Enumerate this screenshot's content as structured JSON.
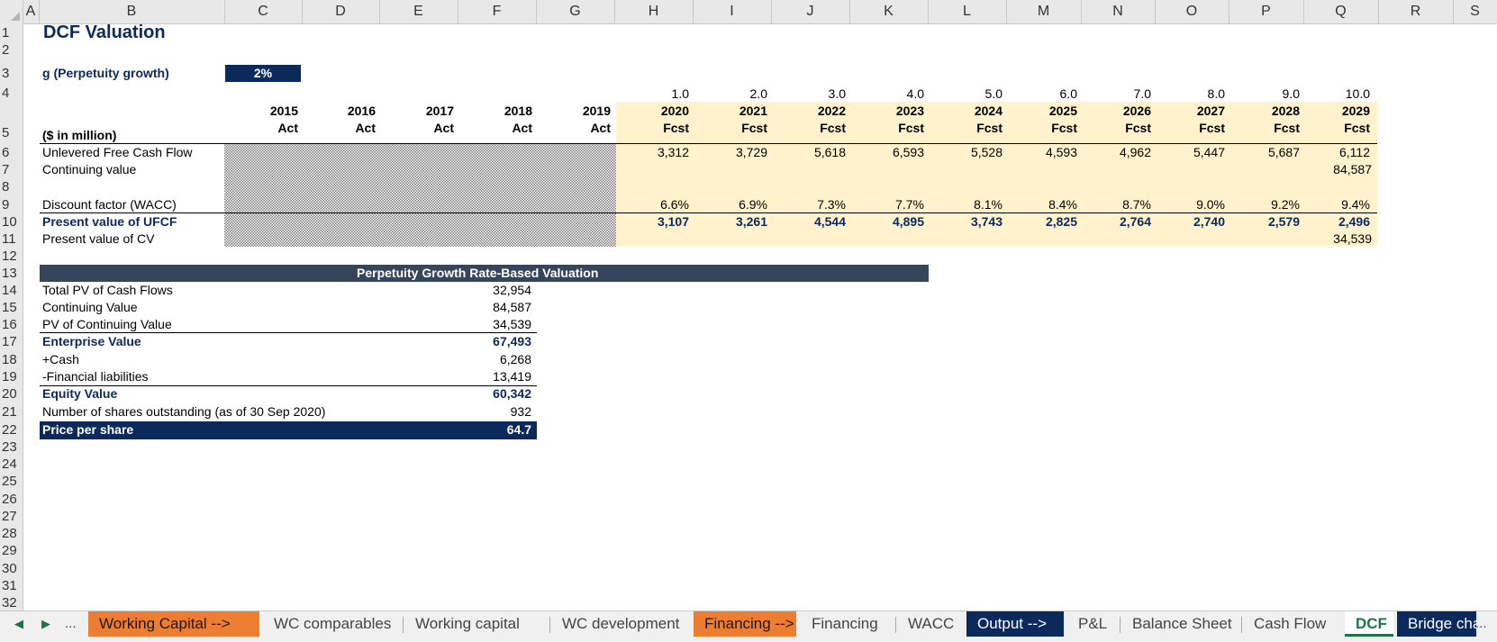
{
  "columns": [
    "A",
    "B",
    "C",
    "D",
    "E",
    "F",
    "G",
    "H",
    "I",
    "J",
    "K",
    "L",
    "M",
    "N",
    "O",
    "P",
    "Q",
    "R",
    "S"
  ],
  "rows": [
    "1",
    "2",
    "3",
    "4",
    "5",
    "6",
    "7",
    "8",
    "9",
    "10",
    "11",
    "12",
    "13",
    "14",
    "15",
    "16",
    "17",
    "18",
    "19",
    "20",
    "21",
    "22",
    "23",
    "24",
    "25",
    "26",
    "27",
    "28",
    "29",
    "30",
    "31",
    "32"
  ],
  "sheet": {
    "title": "DCF Valuation",
    "g_label": "g (Perpetuity growth)",
    "g_value": "2%",
    "units_label": "($ in million)",
    "periods": [
      "1.0",
      "2.0",
      "3.0",
      "4.0",
      "5.0",
      "6.0",
      "7.0",
      "8.0",
      "9.0",
      "10.0"
    ],
    "years": [
      "2015",
      "2016",
      "2017",
      "2018",
      "2019",
      "2020",
      "2021",
      "2022",
      "2023",
      "2024",
      "2025",
      "2026",
      "2027",
      "2028",
      "2029"
    ],
    "types": [
      "Act",
      "Act",
      "Act",
      "Act",
      "Act",
      "Fcst",
      "Fcst",
      "Fcst",
      "Fcst",
      "Fcst",
      "Fcst",
      "Fcst",
      "Fcst",
      "Fcst",
      "Fcst"
    ],
    "row_labels": {
      "ufcf": "Unlevered Free Cash Flow",
      "cv": "Continuing value",
      "df": "Discount factor (WACC)",
      "pv_ufcf": "Present value of UFCF",
      "pv_cv": "Present value of CV"
    },
    "ufcf": [
      "3,312",
      "3,729",
      "5,618",
      "6,593",
      "5,528",
      "4,593",
      "4,962",
      "5,447",
      "5,687",
      "6,112"
    ],
    "cv_last": "84,587",
    "df": [
      "6.6%",
      "6.9%",
      "7.3%",
      "7.7%",
      "8.1%",
      "8.4%",
      "8.7%",
      "9.0%",
      "9.2%",
      "9.4%"
    ],
    "pv_ufcf": [
      "3,107",
      "3,261",
      "4,544",
      "4,895",
      "3,743",
      "2,825",
      "2,764",
      "2,740",
      "2,579",
      "2,496"
    ],
    "pv_cv_last": "34,539"
  },
  "valuation": {
    "banner": "Perpetuity Growth Rate-Based Valuation",
    "rows": [
      {
        "label": "Total PV of Cash Flows",
        "value": "32,954"
      },
      {
        "label": "Continuing Value",
        "value": "84,587"
      },
      {
        "label": "PV of Continuing Value",
        "value": "34,539"
      },
      {
        "label": "Enterprise Value",
        "value": "67,493"
      },
      {
        "label": "+Cash",
        "value": "6,268"
      },
      {
        "label": "-Financial liabilities",
        "value": "13,419"
      },
      {
        "label": "Equity Value",
        "value": "60,342"
      },
      {
        "label": "Number of shares outstanding (as of 30 Sep 2020)",
        "value": "932"
      },
      {
        "label": "Price per share",
        "value": "64.7"
      }
    ]
  },
  "tabs": {
    "more_left": "...",
    "more_right": "...",
    "items": [
      "Working Capital -->",
      "WC comparables",
      "Working capital",
      "WC development",
      "Financing -->",
      "Financing",
      "WACC",
      "Output -->",
      "P&L",
      "Balance Sheet",
      "Cash Flow",
      "DCF",
      "Bridge cha"
    ]
  },
  "colors": {
    "navy": "#0b2a5b",
    "orange": "#ed7d31",
    "forecast_fill": "#fff2cc",
    "banner": "#37455a",
    "active_tab": "#217346"
  }
}
